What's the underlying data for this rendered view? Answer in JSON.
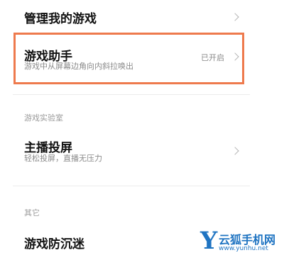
{
  "items": {
    "manage_games": {
      "title": "管理我的游戏"
    },
    "game_assistant": {
      "title": "游戏助手",
      "subtitle": "游戏中从屏幕边角向内斜拉唤出",
      "status": "已开启"
    },
    "lab_section": {
      "label": "游戏实验室"
    },
    "streamer_cast": {
      "title": "主播投屏",
      "subtitle": "轻松投屏，直播无压力"
    },
    "other_section": {
      "label": "其它"
    },
    "anti_addiction": {
      "title": "游戏防沉迷"
    }
  },
  "watermark": {
    "cn_text": "云狐手机网",
    "url": "www.yunhu.net",
    "color": "#1f74c2"
  },
  "colors": {
    "highlight": "#ee7a4d"
  }
}
